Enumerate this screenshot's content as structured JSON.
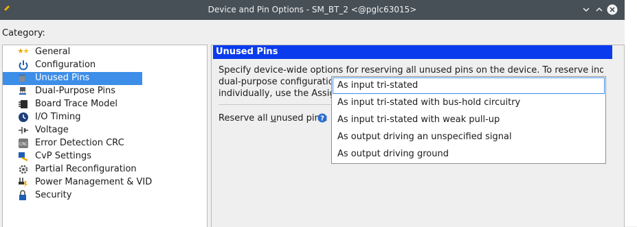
{
  "window": {
    "title": "Device and Pin Options - SM_BT_2 <@pglc63015>",
    "app_icon": "pencil-icon",
    "buttons": [
      "minimize-icon",
      "maximize-icon",
      "close-icon"
    ]
  },
  "category": {
    "label": "Category:",
    "items": [
      {
        "label": "General",
        "icon": "stars-icon"
      },
      {
        "label": "Configuration",
        "icon": "power-icon"
      },
      {
        "label": "Unused Pins",
        "icon": "pin-icon",
        "selected": true
      },
      {
        "label": "Dual-Purpose Pins",
        "icon": "dual-pin-icon"
      },
      {
        "label": "Board Trace Model",
        "icon": "board-trace-icon"
      },
      {
        "label": "I/O Timing",
        "icon": "clock-icon"
      },
      {
        "label": "Voltage",
        "icon": "voltage-icon"
      },
      {
        "label": "Error Detection CRC",
        "icon": "crc-icon"
      },
      {
        "label": "CvP Settings",
        "icon": "cvp-icon"
      },
      {
        "label": "Partial Reconfiguration",
        "icon": "gear-icon"
      },
      {
        "label": "Power Management & VID",
        "icon": "power-plug-icon"
      },
      {
        "label": "Security",
        "icon": "lock-icon"
      }
    ]
  },
  "panel": {
    "header": "Unused Pins",
    "description_lines": [
      "Specify device-wide options for reserving all unused pins on the device. To reserve individual",
      "dual-purpose configuration",
      "individually, use the Assignm"
    ],
    "reserve_label_pre": "Reserve all ",
    "reserve_label_underlined": "u",
    "reserve_label_post": "nused pins:",
    "help_icon": "help-icon"
  },
  "dropdown": {
    "options": [
      "As input tri-stated",
      "As input tri-stated with bus-hold circuitry",
      "As input tri-stated with weak pull-up",
      "As output driving an unspecified signal",
      "As output driving ground"
    ],
    "selected_index": 0
  },
  "colors": {
    "titlebar": "#475057",
    "header": "#0a3cee",
    "selection": "#3d8ee8"
  }
}
